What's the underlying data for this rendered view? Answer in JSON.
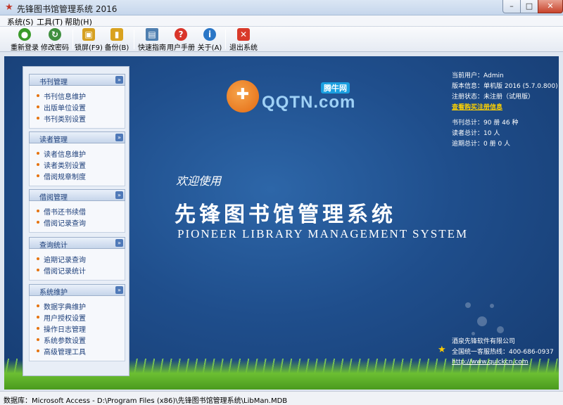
{
  "window": {
    "title": "先锋图书馆管理系统 2016",
    "minimize": "–",
    "maximize": "□",
    "close": "✕"
  },
  "menu": [
    {
      "label": "系统(S)"
    },
    {
      "label": "工具(T)"
    },
    {
      "label": "帮助(H)"
    }
  ],
  "toolbar": [
    {
      "label": "重新登录",
      "icon": "user-login-icon",
      "color": "#3a9a2a",
      "glyph": "●"
    },
    {
      "label": "修改密码",
      "icon": "change-password-icon",
      "color": "#3f8f3f",
      "glyph": "↻"
    },
    {
      "label": "锁屏(F9)",
      "icon": "lock-icon",
      "color": "#d6a020",
      "glyph": "▣"
    },
    {
      "label": "备份(B)",
      "icon": "database-backup-icon",
      "color": "#d9a21f",
      "glyph": "▮"
    },
    {
      "label": "快速指南",
      "icon": "quick-guide-icon",
      "color": "#4f7fb0",
      "glyph": "▤"
    },
    {
      "label": "用户手册",
      "icon": "help-icon",
      "color": "#d9352a",
      "glyph": "?"
    },
    {
      "label": "关于(A)",
      "icon": "info-icon",
      "color": "#2a76c6",
      "glyph": "i"
    },
    {
      "label": "退出系统",
      "icon": "exit-icon",
      "color": "#d93a2a",
      "glyph": "✕"
    }
  ],
  "sidebar": {
    "groups": [
      {
        "title": "书刊管理",
        "items": [
          "书刊信息维护",
          "出版单位设置",
          "书刊类别设置"
        ]
      },
      {
        "title": "读者管理",
        "items": [
          "读者信息维护",
          "读者类别设置",
          "借阅规章制度"
        ]
      },
      {
        "title": "借阅管理",
        "items": [
          "借书还书续借",
          "借阅记录查询"
        ]
      },
      {
        "title": "查询统计",
        "items": [
          "逾期记录查询",
          "借阅记录统计"
        ]
      },
      {
        "title": "系统维护",
        "items": [
          "数据字典维护",
          "用户授权设置",
          "操作日志管理",
          "系统参数设置",
          "高级管理工具"
        ]
      }
    ]
  },
  "logo": {
    "text": "QQTN.com",
    "badge": "腾牛网",
    "glyph": "✚"
  },
  "splash": {
    "welcome": "欢迎使用",
    "title": "先锋图书馆管理系统",
    "english": "PIONEER LIBRARY MANAGEMENT SYSTEM"
  },
  "info": {
    "user": "当前用户：Admin",
    "version": "版本信息：单机版 2016 (5.7.0.800)",
    "register": "注册状态：未注册（试用版）",
    "buy_link": "查看购买注册信息",
    "books": "书刊总计：90 册 46 种",
    "readers": "读者总计：10 人",
    "overdue": "逾期总计：0 册 0 人"
  },
  "footer": {
    "company": "酒泉先锋软件有限公司",
    "hotline": "全国统一客服热线：400-686-0937",
    "website": "http://www.quickcn.com",
    "star": "★"
  },
  "status": {
    "text": "数据库：Microsoft Access - D:\\Program Files (x86)\\先锋图书馆管理系统\\LibMan.MDB"
  }
}
